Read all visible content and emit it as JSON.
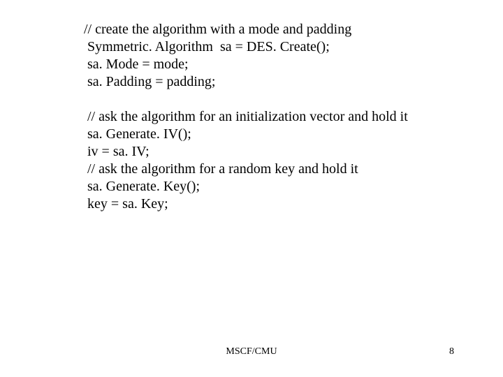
{
  "code": {
    "line1": "// create the algorithm with a mode and padding",
    "line2": " Symmetric. Algorithm  sa = DES. Create();",
    "line3": " sa. Mode = mode;",
    "line4": " sa. Padding = padding;",
    "line5": " // ask the algorithm for an initialization vector and hold it",
    "line6": " sa. Generate. IV();",
    "line7": " iv = sa. IV;",
    "line8": " // ask the algorithm for a random key and hold it",
    "line9": " sa. Generate. Key();",
    "line10": " key = sa. Key;"
  },
  "footer": {
    "center": "MSCF/CMU",
    "page": "8"
  }
}
